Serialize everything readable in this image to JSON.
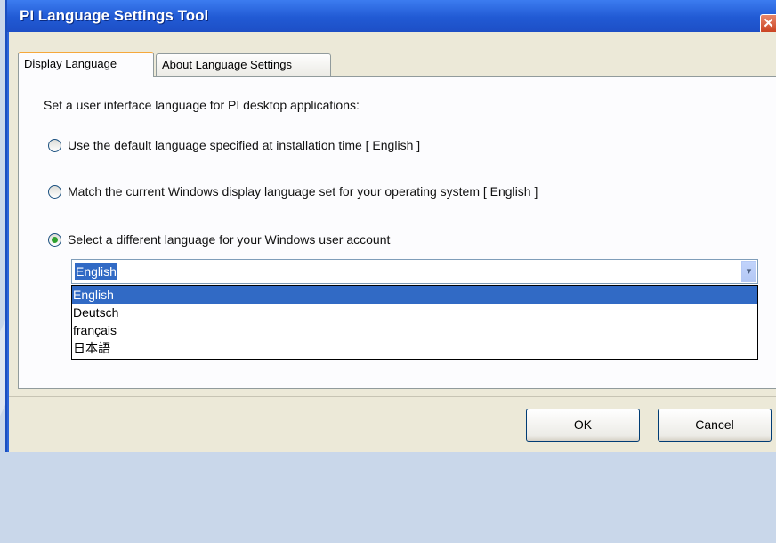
{
  "window": {
    "title": "PI Language Settings Tool",
    "close_glyph": "✕"
  },
  "tabs": [
    {
      "label": "Display Language",
      "active": true
    },
    {
      "label": "About Language Settings",
      "active": false
    }
  ],
  "intro": "Set a user interface language for PI desktop applications:",
  "options": [
    {
      "label": "Use the default language specified at installation time [ English ]",
      "checked": false
    },
    {
      "label": "Match the current Windows display language set for your operating system [ English ]",
      "checked": false
    },
    {
      "label": "Select a different language for your Windows user account",
      "checked": true
    }
  ],
  "language_select": {
    "value": "English",
    "items": [
      "English",
      "Deutsch",
      "français",
      "日本語"
    ],
    "arrow_glyph": "▾"
  },
  "buttons": {
    "ok": "OK",
    "cancel": "Cancel"
  },
  "colors": {
    "titlebar": "#215ad4",
    "selection": "#316ac5",
    "tab_accent": "#f5a83b",
    "client": "#ece9d8"
  }
}
